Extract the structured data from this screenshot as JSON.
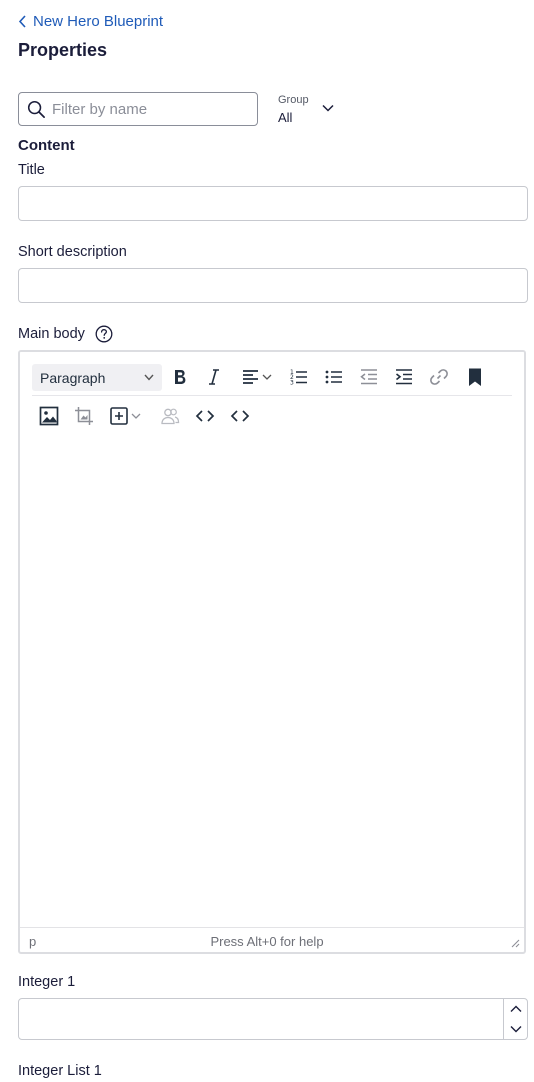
{
  "header": {
    "back_link": "New Hero Blueprint",
    "title": "Properties"
  },
  "filter": {
    "placeholder": "Filter by name",
    "value": ""
  },
  "group": {
    "label": "Group",
    "value": "All"
  },
  "section": {
    "heading": "Content"
  },
  "fields": {
    "title": {
      "label": "Title",
      "value": ""
    },
    "short_description": {
      "label": "Short description",
      "value": ""
    },
    "main_body": {
      "label": "Main body"
    },
    "integer_1": {
      "label": "Integer 1",
      "value": ""
    },
    "integer_list_1": {
      "label": "Integer List 1"
    }
  },
  "editor": {
    "block_format": "Paragraph",
    "status_path": "p",
    "status_help": "Press Alt+0 for help",
    "toolbar_icons": [
      "bold-icon",
      "italic-icon",
      "align-icon",
      "numbered-list-icon",
      "bulleted-list-icon",
      "outdent-icon",
      "indent-icon",
      "link-icon",
      "bookmark-icon",
      "image-icon",
      "crop-image-icon",
      "insert-icon",
      "users-icon",
      "code-icon",
      "source-code-icon"
    ]
  },
  "colors": {
    "link": "#1f5bb8",
    "text": "#1b1d3a",
    "border": "#c7c9cf"
  }
}
